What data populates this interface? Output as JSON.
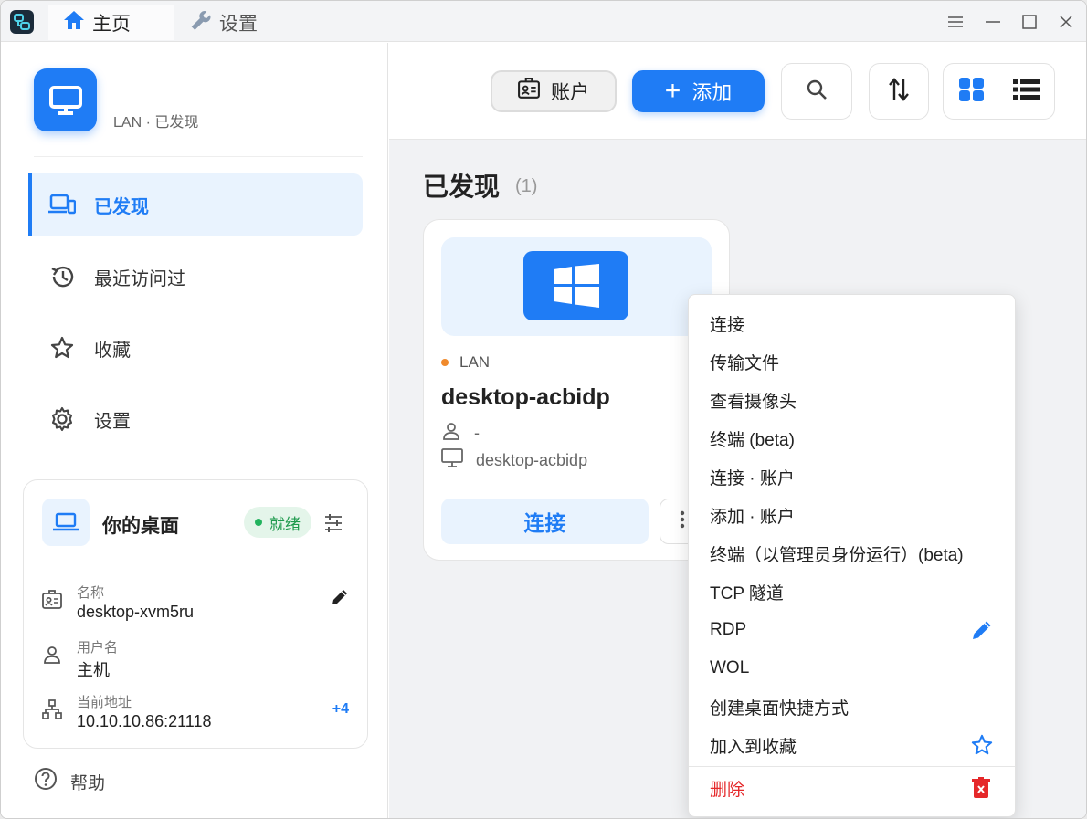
{
  "titlebar": {
    "tabs": [
      {
        "label": "主页",
        "icon": "home-icon",
        "active": true
      },
      {
        "label": "设置",
        "icon": "wrench-icon",
        "active": false
      }
    ],
    "controls": [
      "menu-icon",
      "minimize-icon",
      "maximize-icon",
      "close-icon"
    ]
  },
  "sidebar": {
    "brand_subtitle": "LAN · 已发现",
    "nav": [
      {
        "label": "已发现",
        "icon": "devices-icon",
        "active": true
      },
      {
        "label": "最近访问过",
        "icon": "history-icon",
        "active": false
      },
      {
        "label": "收藏",
        "icon": "star-icon",
        "active": false
      },
      {
        "label": "设置",
        "icon": "gear-icon",
        "active": false
      }
    ],
    "desktop_card": {
      "title": "你的桌面",
      "status": "就绪",
      "fields": [
        {
          "label": "名称",
          "value": "desktop-xvm5ru",
          "icon": "id-card-icon",
          "action": "edit"
        },
        {
          "label": "用户名",
          "value": "主机",
          "icon": "user-icon"
        },
        {
          "label": "当前地址",
          "value": "10.10.10.86:21118",
          "icon": "network-icon",
          "action": "+4"
        }
      ]
    },
    "help_label": "帮助"
  },
  "toolbar": {
    "account_label": "账户",
    "add_label": "添加"
  },
  "main": {
    "section_title": "已发现",
    "section_count": "(1)",
    "peer": {
      "network": "LAN",
      "name": "desktop-acbidp",
      "username": "-",
      "hostname": "desktop-acbidp",
      "connect_label": "连接"
    }
  },
  "context_menu": {
    "items": [
      {
        "label": "连接"
      },
      {
        "label": "传输文件"
      },
      {
        "label": "查看摄像头"
      },
      {
        "label": "终端 (beta)"
      },
      {
        "label": "连接 · 账户"
      },
      {
        "label": "添加 · 账户"
      },
      {
        "label": "终端（以管理员身份运行）(beta)"
      },
      {
        "label": "TCP 隧道"
      },
      {
        "label": "RDP",
        "icon": "edit-icon"
      },
      {
        "label": "WOL"
      },
      {
        "label": "创建桌面快捷方式"
      },
      {
        "label": "加入到收藏",
        "icon": "star-icon"
      }
    ],
    "danger_item": {
      "label": "删除",
      "icon": "trash-icon"
    }
  },
  "colors": {
    "accent": "#1f7cf5",
    "ready": "#22b35e",
    "lan_dot": "#f08a2c",
    "danger": "#e5282a"
  }
}
